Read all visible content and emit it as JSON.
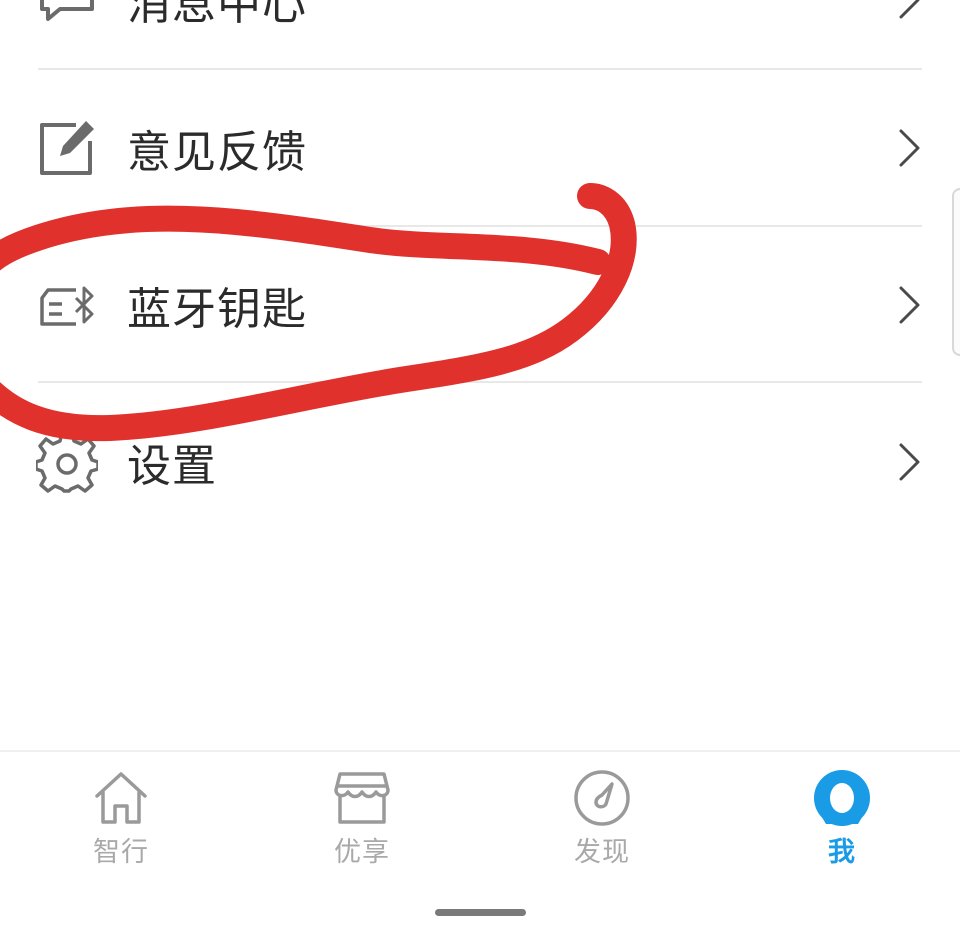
{
  "menu": {
    "items": [
      {
        "label": "消息中心",
        "icon": "message-icon"
      },
      {
        "label": "意见反馈",
        "icon": "edit-icon"
      },
      {
        "label": "蓝牙钥匙",
        "icon": "bluetooth-key-icon"
      },
      {
        "label": "设置",
        "icon": "gear-icon"
      }
    ]
  },
  "tabbar": {
    "tabs": [
      {
        "label": "智行",
        "icon": "home-icon",
        "active": false
      },
      {
        "label": "优享",
        "icon": "store-icon",
        "active": false
      },
      {
        "label": "发现",
        "icon": "compass-icon",
        "active": false
      },
      {
        "label": "我",
        "icon": "profile-icon",
        "active": true
      }
    ],
    "active_color": "#1a9be6",
    "inactive_color": "#a9a9a9"
  },
  "annotation": {
    "color": "#e0312c",
    "shape": "hand-drawn-loop-around-bluetooth-key"
  }
}
